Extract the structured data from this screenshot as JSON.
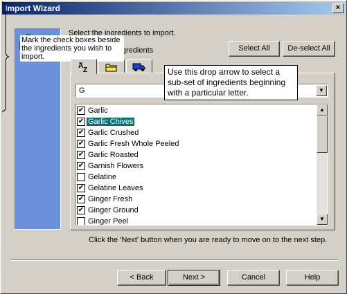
{
  "window": {
    "title": "Import Wizard",
    "close_glyph": "×"
  },
  "header": {
    "instruction": "Select the ingredients to import.",
    "import_all_label": "Import all ingredients",
    "select_all": "Select All",
    "deselect_all": "De-select All"
  },
  "tabs": [
    {
      "name": "alphabetical",
      "icon": "az-sort-icon",
      "active": true
    },
    {
      "name": "folder",
      "icon": "folder-icon",
      "active": false
    },
    {
      "name": "supplier",
      "icon": "truck-icon",
      "active": false
    }
  ],
  "filter": {
    "value": "G",
    "arrow": "▼"
  },
  "ingredients": [
    {
      "label": "Garlic",
      "checked": true,
      "selected": false
    },
    {
      "label": "Garlic Chives",
      "checked": true,
      "selected": true
    },
    {
      "label": "Garlic Crushed",
      "checked": true,
      "selected": false
    },
    {
      "label": "Garlic Fresh Whole Peeled",
      "checked": true,
      "selected": false
    },
    {
      "label": "Garlic Roasted",
      "checked": true,
      "selected": false
    },
    {
      "label": "Garnish Flowers",
      "checked": true,
      "selected": false
    },
    {
      "label": "Gelatine",
      "checked": false,
      "selected": false
    },
    {
      "label": "Gelatine Leaves",
      "checked": true,
      "selected": false
    },
    {
      "label": "Ginger Fresh",
      "checked": true,
      "selected": false
    },
    {
      "label": "Ginger Ground",
      "checked": true,
      "selected": false
    },
    {
      "label": "Ginger Peel",
      "checked": false,
      "selected": false
    }
  ],
  "callouts": {
    "dropdown": "Use this drop arrow to select a sub-set of ingredients beginning with a particular letter.",
    "checkboxes": "Mark the check boxes beside the ingredients you wish to import."
  },
  "footer_text": "Click the 'Next' button when you are ready to move on to the next step.",
  "buttons": {
    "back": "< Back",
    "next": "Next >",
    "cancel": "Cancel",
    "help": "Help"
  },
  "colors": {
    "panel": "#6b8fd8",
    "selection": "#0a7070",
    "titlebar": "#0a246a"
  }
}
